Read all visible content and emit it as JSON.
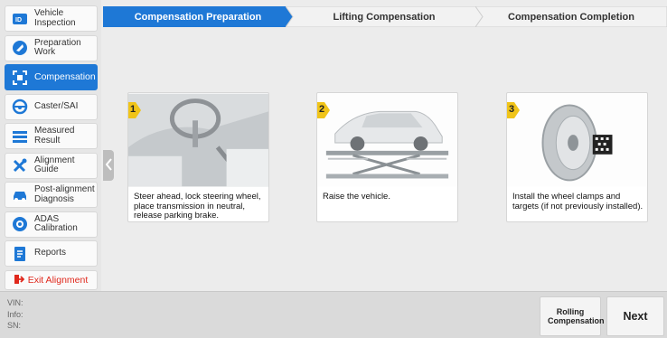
{
  "sidebar": {
    "items": [
      {
        "label": "Vehicle Inspection",
        "icon": "vin-id-icon",
        "active": false
      },
      {
        "label": "Preparation Work",
        "icon": "wrench-tag-icon",
        "active": false
      },
      {
        "label": "Compensation",
        "icon": "compensation-icon",
        "active": true
      },
      {
        "label": "Caster/SAI",
        "icon": "steering-wheel-icon",
        "active": false
      },
      {
        "label": "Measured Result",
        "icon": "list-result-icon",
        "active": false
      },
      {
        "label": "Alignment Guide",
        "icon": "tools-icon",
        "active": false
      },
      {
        "label": "Post-alignment Diagnosis",
        "icon": "car-diagnosis-icon",
        "active": false
      },
      {
        "label": "ADAS Calibration",
        "icon": "adas-camera-icon",
        "active": false
      },
      {
        "label": "Reports",
        "icon": "report-icon",
        "active": false
      }
    ],
    "exit_label": "Exit Alignment"
  },
  "steps": [
    {
      "label": "Compensation Preparation",
      "active": true
    },
    {
      "label": "Lifting Compensation",
      "active": false
    },
    {
      "label": "Compensation Completion",
      "active": false
    }
  ],
  "cards": [
    {
      "number": "1",
      "text": "Steer ahead, lock steering wheel, place transmission in neutral, release parking brake."
    },
    {
      "number": "2",
      "text": "Raise the vehicle."
    },
    {
      "number": "3",
      "text": "Install the wheel clamps and targets (if not previously installed)."
    }
  ],
  "bottom": {
    "vin_label": "VIN:",
    "info_label": "Info:",
    "sn_label": "SN:",
    "rolling_label": "Rolling Compensation",
    "next_label": "Next"
  },
  "colors": {
    "accent": "#1e78d6",
    "exit_red": "#e0281c",
    "step_badge": "#f0c419"
  }
}
